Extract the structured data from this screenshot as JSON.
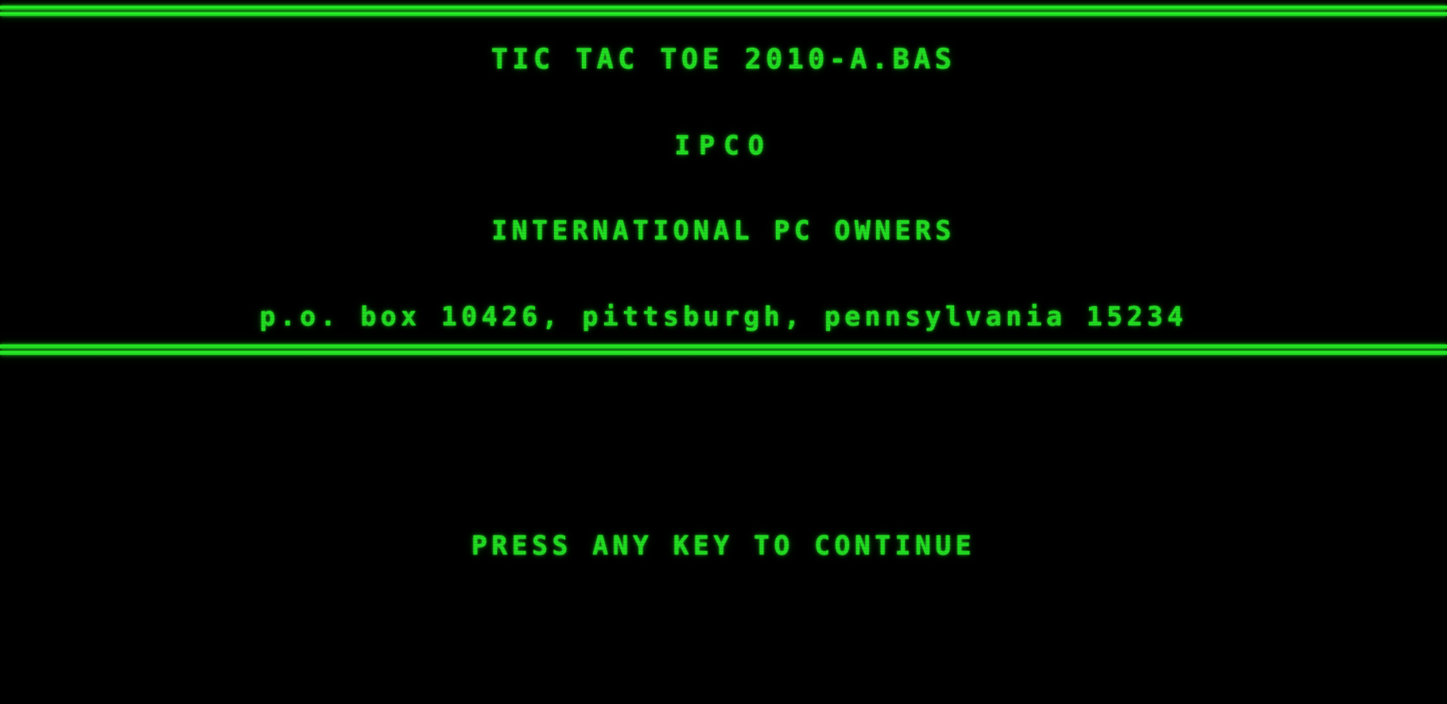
{
  "screen": {
    "background_color": "#000000",
    "text_color": "#22dd22",
    "rule_color": "#1fdc1f"
  },
  "header": {
    "title": "TIC TAC TOE 2010-A.BAS",
    "org_short": "IPCO",
    "org_full": "INTERNATIONAL PC OWNERS",
    "address": "p.o. box 10426, pittsburgh, pennsylvania 15234"
  },
  "prompt": {
    "message": "PRESS ANY KEY TO CONTINUE"
  }
}
